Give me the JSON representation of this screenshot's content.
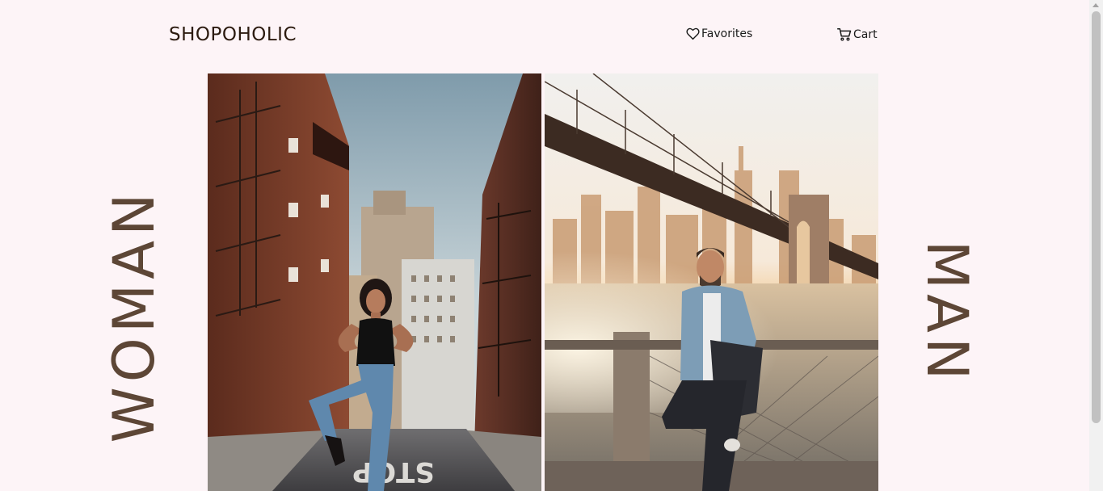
{
  "header": {
    "brand": "SHOPOHOLIC",
    "nav": {
      "favorites_label": "Favorites",
      "cart_label": "Cart"
    }
  },
  "categories": {
    "woman_label": "WOMAN",
    "man_label": "MAN"
  },
  "icons": {
    "favorites": "heart-icon",
    "cart": "cart-icon"
  },
  "colors": {
    "background": "#fdf4f7",
    "brand_text": "#2c1b10",
    "category_text": "#5d4636"
  }
}
